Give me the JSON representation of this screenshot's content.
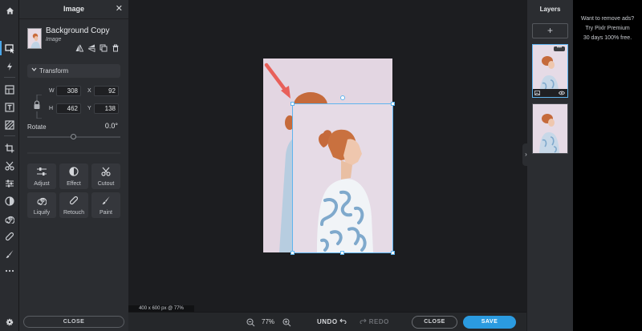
{
  "panel": {
    "title": "Image",
    "close_glyph": "✕",
    "layer_name": "Background Copy",
    "layer_type": "Image",
    "transform_label": "Transform",
    "fields": {
      "w_label": "W",
      "w_value": "308",
      "x_label": "X",
      "x_value": "92",
      "h_label": "H",
      "h_value": "462",
      "y_label": "Y",
      "y_value": "138"
    },
    "rotate_label": "Rotate",
    "rotate_value": "0.0°",
    "tools": [
      {
        "label": "Adjust",
        "icon": "sliders-icon"
      },
      {
        "label": "Effect",
        "icon": "effect-icon"
      },
      {
        "label": "Cutout",
        "icon": "scissors-icon"
      },
      {
        "label": "Liquify",
        "icon": "spiral-icon"
      },
      {
        "label": "Retouch",
        "icon": "bandage-icon"
      },
      {
        "label": "Paint",
        "icon": "brush-icon"
      }
    ],
    "close_label": "CLOSE"
  },
  "canvas": {
    "info": "400 x 600 px @ 77%"
  },
  "bottom": {
    "zoom": "77%",
    "undo": "UNDO",
    "redo": "REDO",
    "close": "CLOSE",
    "save": "SAVE"
  },
  "layers": {
    "title": "Layers",
    "add_glyph": "+",
    "more_glyph": "•••"
  },
  "ad": {
    "line1": "Want to remove ads?",
    "line2": "Try Pixlr Premium",
    "line3": "30 days 100% free."
  },
  "colors": {
    "accent": "#2b9be0",
    "selection": "#5fb4ee",
    "arrow": "#e8605a",
    "photo_bg": "#e3d6e2"
  }
}
